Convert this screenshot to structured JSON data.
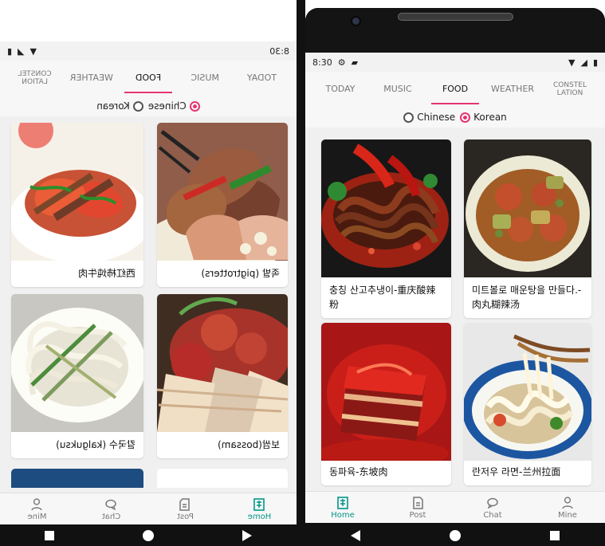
{
  "screens": {
    "left": {
      "status_time": "8:30",
      "tabs": [
        {
          "label": "TODAY"
        },
        {
          "label": "MUSIC"
        },
        {
          "label": "FOOD"
        },
        {
          "label": "WEATHER"
        },
        {
          "label": "CONSTEL\nLATION"
        }
      ],
      "radio": {
        "chinese": "Chinese",
        "korean": "Korean",
        "selected": "Chinese"
      },
      "cards": [
        {
          "caption": "족발 (pigtrotters)"
        },
        {
          "caption": "西红柿炖牛肉"
        },
        {
          "caption": "보쌈(bossam)"
        },
        {
          "caption": "칼국수 (kalguksu)"
        }
      ],
      "bottom_nav": [
        {
          "label": "Home",
          "icon": "home-book-icon"
        },
        {
          "label": "Post",
          "icon": "post-icon"
        },
        {
          "label": "Chat",
          "icon": "chat-icon"
        },
        {
          "label": "Mine",
          "icon": "person-icon"
        }
      ]
    },
    "right": {
      "status_time": "8:30",
      "tabs": [
        {
          "label": "TODAY"
        },
        {
          "label": "MUSIC"
        },
        {
          "label": "FOOD"
        },
        {
          "label": "WEATHER"
        },
        {
          "label": "CONSTEL\nLATION"
        }
      ],
      "radio": {
        "chinese": "Chinese",
        "korean": "Korean",
        "selected": "Korean"
      },
      "cards": [
        {
          "caption": "충칭 산고추냉이-重庆酸辣粉"
        },
        {
          "caption": "미트볼로 매운탕을 만들다.-肉丸糊辣汤"
        },
        {
          "caption": "동파육-东坡肉"
        },
        {
          "caption": "란저우 라면-兰州拉面"
        }
      ],
      "bottom_nav": [
        {
          "label": "Home",
          "icon": "home-book-icon"
        },
        {
          "label": "Post",
          "icon": "post-icon"
        },
        {
          "label": "Chat",
          "icon": "chat-icon"
        },
        {
          "label": "Mine",
          "icon": "person-icon"
        }
      ]
    }
  },
  "colors": {
    "accent": "#e53473",
    "active_nav": "#009688",
    "surface": "#f7f7f7",
    "background": "#f0f0f0"
  }
}
